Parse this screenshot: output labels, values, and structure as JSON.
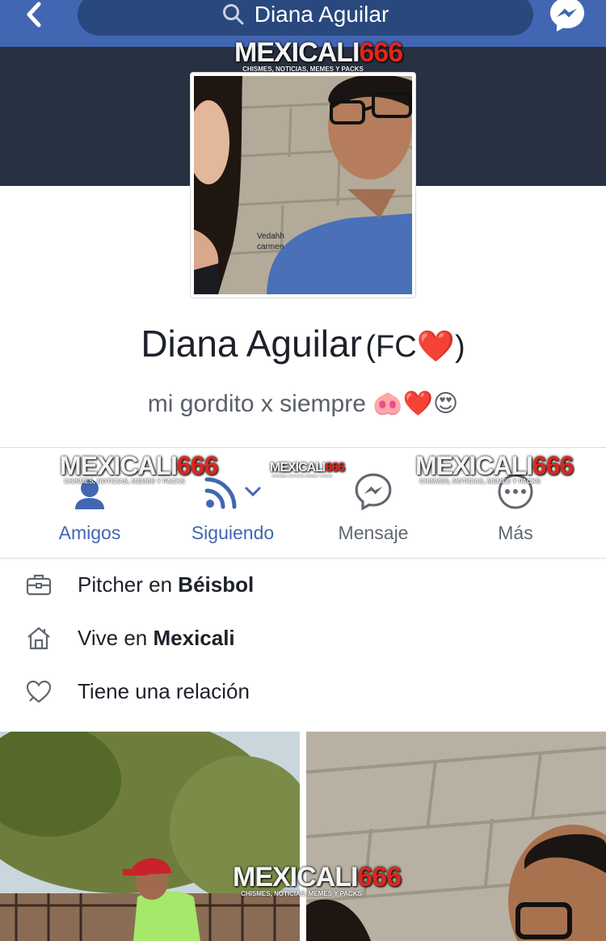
{
  "topbar": {
    "search_value": "Diana Aguilar",
    "colors": {
      "bar": "#4267b2",
      "search_bg": "#29487d"
    }
  },
  "watermark": {
    "part_a": "MEXICALI",
    "part_b": "666",
    "tagline": "CHISMES, NOTICIAS, MEMES Y PACKS"
  },
  "profile": {
    "photo_caption": "Vedahh\ncarmen",
    "name": "Diana Aguilar",
    "name_suffix": "(FC❤️)",
    "bio": "mi gordito x siempre 🐽❤️😍"
  },
  "actions": [
    {
      "label": "Amigos",
      "icon": "friends-icon"
    },
    {
      "label": "Siguiendo",
      "icon": "following-icon"
    },
    {
      "label": "Mensaje",
      "icon": "messenger-icon"
    },
    {
      "label": "Más",
      "icon": "more-icon"
    }
  ],
  "intro": [
    {
      "prefix": "Pitcher en ",
      "bold": "Béisbol",
      "icon": "briefcase-icon"
    },
    {
      "prefix": "Vive en ",
      "bold": "Mexicali",
      "icon": "home-icon"
    },
    {
      "prefix": "Tiene una relación",
      "bold": "",
      "icon": "heart-icon"
    }
  ]
}
